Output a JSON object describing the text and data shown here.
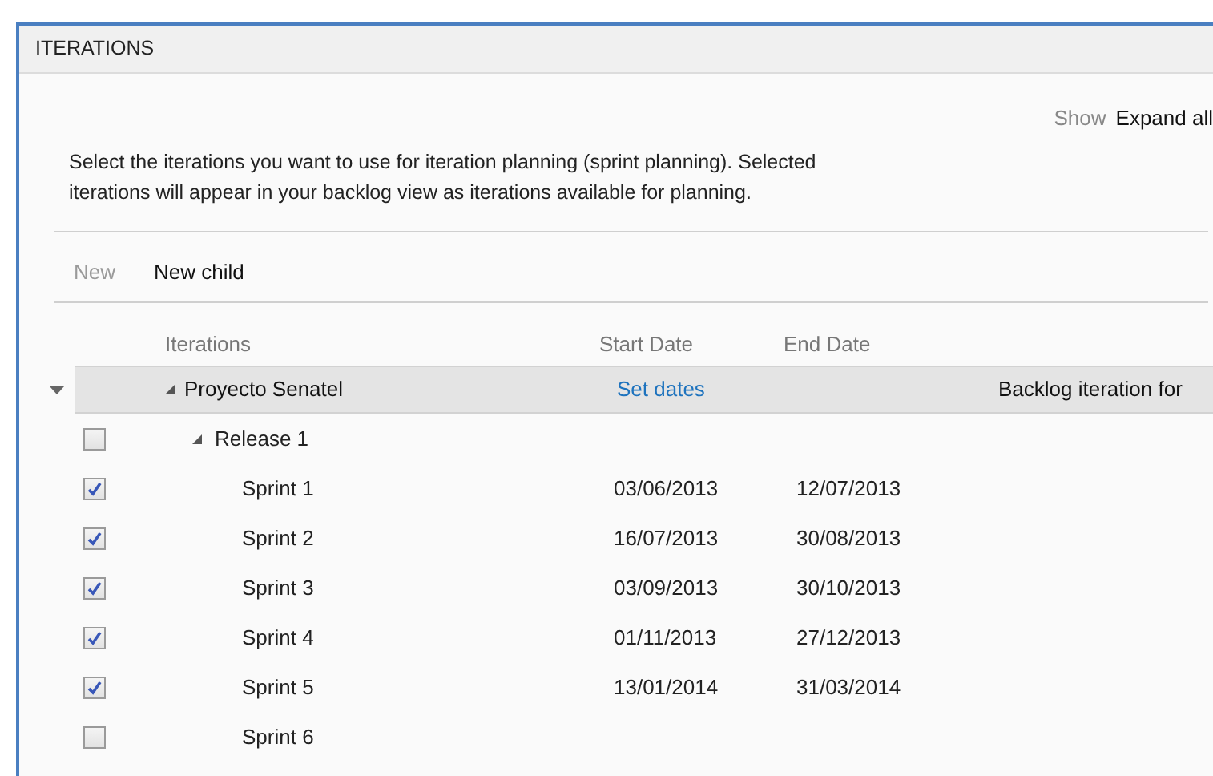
{
  "window": {
    "title": "ITERATIONS"
  },
  "show": {
    "label": "Show",
    "value": "Expand all"
  },
  "description": "Select the iterations you want to use for iteration planning (sprint planning). Selected iterations will appear in your backlog view as iterations available for planning.",
  "toolbar": [
    {
      "label": "New",
      "disabled": true
    },
    {
      "label": "New child",
      "disabled": false
    }
  ],
  "table": {
    "columns": [
      "Iterations",
      "Start Date",
      "End Date"
    ],
    "root": {
      "name": "Proyecto Senatel",
      "selected": true,
      "expanded": true,
      "start_date_link": "Set dates",
      "column_4": "Backlog iteration for",
      "children": [
        {
          "name": "Release 1",
          "checked": false,
          "expanded": true,
          "children": [
            {
              "name": "Sprint 1",
              "checked": true,
              "start_date": "03/06/2013",
              "end_date": "12/07/2013"
            },
            {
              "name": "Sprint 2",
              "checked": true,
              "start_date": "16/07/2013",
              "end_date": "30/08/2013"
            },
            {
              "name": "Sprint 3",
              "checked": true,
              "start_date": "03/09/2013",
              "end_date": "30/10/2013"
            },
            {
              "name": "Sprint 4",
              "checked": true,
              "start_date": "01/11/2013",
              "end_date": "27/12/2013"
            },
            {
              "name": "Sprint 5",
              "checked": true,
              "start_date": "13/01/2014",
              "end_date": "31/03/2014"
            },
            {
              "name": "Sprint 6",
              "checked": false
            }
          ]
        }
      ]
    }
  }
}
